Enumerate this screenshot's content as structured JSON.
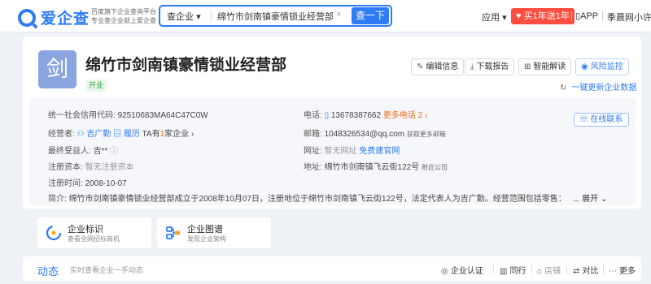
{
  "header": {
    "logo_text": "爱企查",
    "slogan": [
      "百度旗下企业查询平台",
      "专业查企业就上爱企查"
    ],
    "search_scope": "查企业",
    "search_value": "绵竹市剑南镇豪情锁业经营部",
    "search_button": "查一下",
    "nav_app": "应用",
    "nav_vip": "买1年送1年",
    "nav_app_download": "APP",
    "nav_user": "季晨网小许"
  },
  "company": {
    "avatar_char": "剑",
    "name": "绵竹市剑南镇豪情锁业经营部",
    "status": "开业",
    "actions": [
      "编辑信息",
      "下载报告",
      "智能解读",
      "风险监控"
    ],
    "refresh_label": "一键更新企业数据",
    "online_service": "在线联系",
    "credit_code_label": "统一社会信用代码:",
    "credit_code": "92510683MA64C47C0W",
    "operator_label": "经营者:",
    "operator": "吉广勤",
    "operator_profile": "履历",
    "operator_ta_prefix": "TA有",
    "operator_ta_count": "1",
    "operator_ta_suffix": "家企业",
    "beneficiary_label": "最终受益人:",
    "beneficiary": "吉**",
    "capital_label": "注册资本:",
    "capital": "暂无注册资本",
    "reg_time_label": "注册时间:",
    "reg_time": "2008-10-07",
    "phone_label": "电话:",
    "phone": "13678387662",
    "more_phone": "更多电话 2",
    "email_label": "邮箱:",
    "email": "1048326534@qq.com",
    "more_email": "获取更多邮箱",
    "website_label": "网址:",
    "website": "暂无网址",
    "website_build": "免费建官网",
    "address_label": "地址:",
    "address": "绵竹市剑南镇飞云街122号",
    "address_nearby": "附近公司",
    "intro_label": "简介:",
    "intro": "绵竹市剑南镇豪情锁业经营部成立于2008年10月07日，注册地位于绵竹市剑南镇飞云街122号，法定代表人为吉广勤。经营范围包括零售：五金、锁具及开(",
    "expand_label": "... 展开"
  },
  "features": [
    {
      "title": "企业标识",
      "subtitle": "查看全网招标商机"
    },
    {
      "title": "企业图谱",
      "subtitle": "发现企业架构"
    }
  ],
  "dynamics": {
    "title": "动态",
    "subtitle": "实时查看企业一手动态",
    "tabs": [
      "企业认证",
      "同行",
      "店铺",
      "对比",
      "更多"
    ]
  },
  "colors": {
    "accent": "#2d7bf5",
    "vip": "#ff4d3f",
    "status_green": "#2e9e46",
    "orange": "#f06a1d"
  }
}
